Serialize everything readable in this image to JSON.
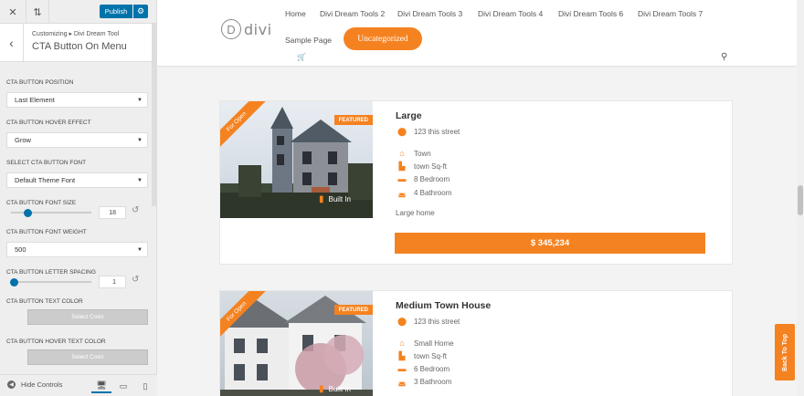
{
  "customizer": {
    "publish_label": "Publish",
    "breadcrumb": "Customizing ▸ Divi Dream Tool",
    "panel_title": "CTA Button On Menu",
    "controls": {
      "position_label": "CTA BUTTON POSITION",
      "position_value": "Last Element",
      "hover_effect_label": "CTA BUTTON HOVER EFFECT",
      "hover_effect_value": "Grow",
      "font_label": "SELECT CTA BUTTON FONT",
      "font_value": "Default Theme Font",
      "font_size_label": "CTA BUTTON FONT SIZE",
      "font_size_value": "18",
      "font_size_fraction": 0.18,
      "font_weight_label": "CTA BUTTON FONT WEIGHT",
      "font_weight_value": "500",
      "letter_spacing_label": "CTA BUTTON LETTER SPACING",
      "letter_spacing_value": "1",
      "letter_spacing_fraction": 0.03,
      "text_color_label": "CTA BUTTON TEXT COLOR",
      "text_color_button": "Select Color",
      "hover_text_color_label": "CTA BUTTON HOVER TEXT COLOR",
      "hover_text_color_button": "Select Color"
    },
    "hide_controls_label": "Hide Controls",
    "accent_color": "#0073aa"
  },
  "site": {
    "logo_letter": "D",
    "logo_text": "divi",
    "nav": [
      "Home",
      "Divi Dream Tools 2",
      "Divi Dream Tools 3",
      "Divi Dream Tools 4",
      "Divi Dream Tools 6",
      "Divi Dream Tools 7",
      "Sample Page"
    ],
    "cta_label": "Uncategorized",
    "brand_color": "#f58220"
  },
  "listings": [
    {
      "ribbon": "For Open",
      "badge": "FEATURED",
      "built_in": "Built In",
      "title": "Large",
      "address": "123 this street",
      "type": "Town",
      "sqft": "town Sq-ft",
      "bedrooms": "8 Bedroom",
      "bathrooms": "4 Bathroom",
      "description": "Large home",
      "price": "$ 345,234"
    },
    {
      "ribbon": "For Open",
      "badge": "FEATURED",
      "built_in": "Built In",
      "title": "Medium Town House",
      "address": "123 this street",
      "type": "Small Home",
      "sqft": "town Sq-ft",
      "bedrooms": "6 Bedroom",
      "bathrooms": "3 Bathroom"
    }
  ],
  "back_to_top": "Back To Top"
}
